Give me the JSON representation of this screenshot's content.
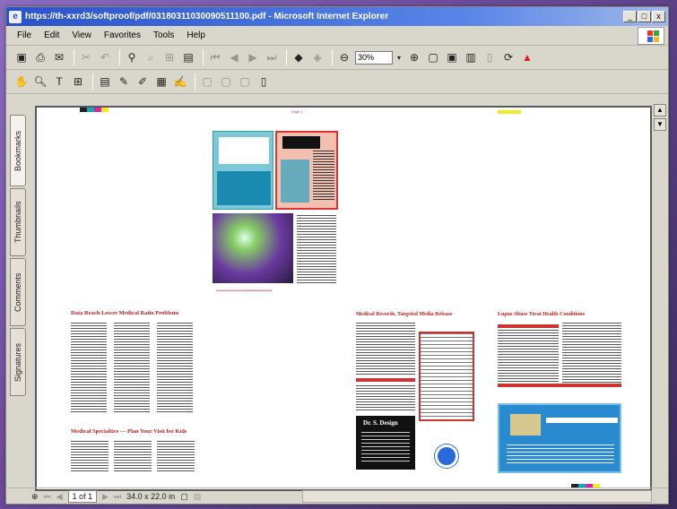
{
  "window": {
    "title": "https://th-xxrd3/softproof/pdf/03180311030090511100.pdf - Microsoft Internet Explorer",
    "controls": [
      "_",
      "□",
      "x"
    ]
  },
  "menu": [
    "File",
    "Edit",
    "View",
    "Favorites",
    "Tools",
    "Help"
  ],
  "toolbar1": {
    "zoom_value": "30%"
  },
  "navtabs": [
    "Bookmarks",
    "Thumbnails",
    "Comments",
    "Signatures"
  ],
  "status": {
    "page": "1 of 1",
    "size": "34.0 x 22.0 in"
  },
  "document": {
    "header_center": "Page 1",
    "pages": {
      "p1_title": "Data Reach Lower Medical Ratio Problems",
      "p1_title2": "Medical Specialties — Plan Your Visit for Kids",
      "p3_title": "Medical Records, Targeted Media Release",
      "p4_title": "Lupus Abuse Treat Health Conditions",
      "p3_ad": "Dr. S. Design"
    }
  },
  "colors": {
    "title_gradient_start": "#2a52c8",
    "accent_red": "#b22222",
    "chrome": "#d9d6cc"
  }
}
